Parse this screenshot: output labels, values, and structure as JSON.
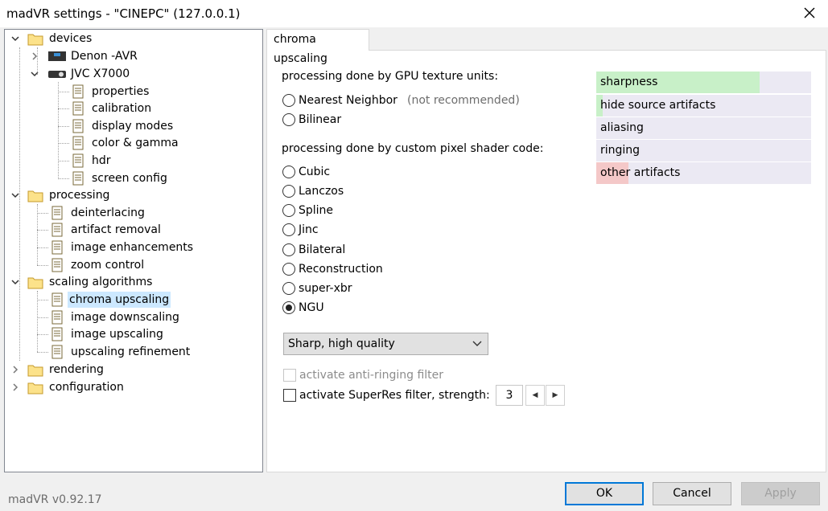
{
  "window": {
    "title": "madVR settings - \"CINEPC\" (127.0.0.1)"
  },
  "tree": {
    "devices": "devices",
    "denon": "Denon -AVR",
    "jvc": "JVC X7000",
    "properties": "properties",
    "calibration": "calibration",
    "display_modes": "display modes",
    "color_gamma": "color & gamma",
    "hdr": "hdr",
    "screen_config": "screen config",
    "processing": "processing",
    "deinterlacing": "deinterlacing",
    "artifact_removal": "artifact removal",
    "image_enhancements": "image enhancements",
    "zoom_control": "zoom control",
    "scaling_algorithms": "scaling algorithms",
    "chroma_upscaling": "chroma upscaling",
    "image_downscaling": "image downscaling",
    "image_upscaling": "image upscaling",
    "upscaling_refinement": "upscaling refinement",
    "rendering": "rendering",
    "configuration": "configuration"
  },
  "tab": {
    "label": "chroma upscaling"
  },
  "panel": {
    "gpu_heading": "processing done by GPU texture units:",
    "nearest": "Nearest Neighbor",
    "nearest_hint": "(not recommended)",
    "bilinear": "Bilinear",
    "shader_heading": "processing done by custom pixel shader code:",
    "cubic": "Cubic",
    "lanczos": "Lanczos",
    "spline": "Spline",
    "jinc": "Jinc",
    "bilateral": "Bilateral",
    "reconstruction": "Reconstruction",
    "superxbr": "super-xbr",
    "ngu": "NGU",
    "selected_algorithm": "NGU",
    "quality_select": "Sharp, high quality",
    "anti_ringing": "activate anti-ringing filter",
    "superres": "activate SuperRes filter, strength:",
    "superres_strength": "3"
  },
  "quality_bars": [
    {
      "label": "sharpness",
      "level": 0.76,
      "color": "#c8f0c8"
    },
    {
      "label": "hide source artifacts",
      "level": 0.03,
      "color": "#c8f0c8"
    },
    {
      "label": "aliasing",
      "level": 0,
      "color": "#c8f0c8"
    },
    {
      "label": "ringing",
      "level": 0,
      "color": "#c8f0c8"
    },
    {
      "label": "other artifacts",
      "level": 0.15,
      "color": "#f4c8c8"
    }
  ],
  "footer": {
    "version": "madVR v0.92.17",
    "ok": "OK",
    "cancel": "Cancel",
    "apply": "Apply"
  }
}
